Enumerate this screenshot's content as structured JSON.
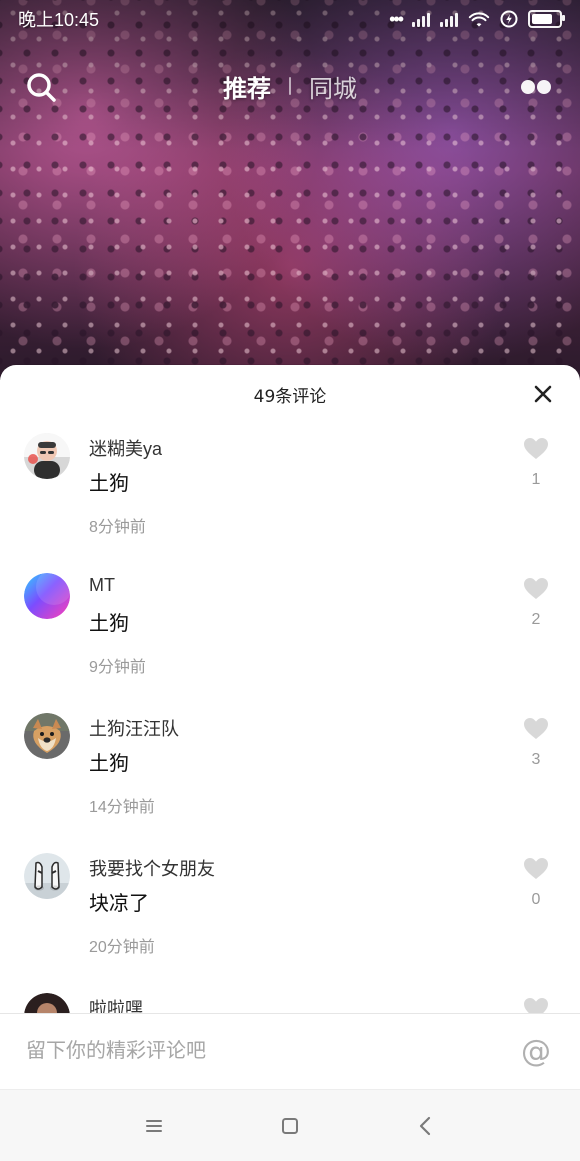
{
  "status_bar": {
    "time": "晚上10:45"
  },
  "top_nav": {
    "tabs": [
      {
        "label": "推荐",
        "active": true
      },
      {
        "label": "同城",
        "active": false
      }
    ],
    "icons": {
      "search": "search-icon",
      "more": "dots-icon"
    }
  },
  "comments_sheet": {
    "title": "49条评论",
    "close_icon": "close-icon",
    "comments": [
      {
        "user": "迷糊美ya",
        "text": "土狗",
        "time": "8分钟前",
        "likes": "1",
        "avatar": "avatar-photo"
      },
      {
        "user": "MT",
        "text": "土狗",
        "time": "9分钟前",
        "likes": "2",
        "avatar": "avatar-gradient"
      },
      {
        "user": "土狗汪汪队",
        "text": "土狗",
        "time": "14分钟前",
        "likes": "3",
        "avatar": "avatar-dog"
      },
      {
        "user": "我要找个女朋友",
        "text": "块凉了",
        "time": "20分钟前",
        "likes": "0",
        "avatar": "avatar-shoes"
      }
    ],
    "partial_comment": {
      "user": "啦啦嘿"
    },
    "input": {
      "placeholder": "留下你的精彩评论吧"
    },
    "mention_icon": "at-icon"
  },
  "system_nav": {
    "icons": [
      "menu-icon",
      "home-icon",
      "back-icon"
    ]
  },
  "colors": {
    "accent_pink": "#ff4fa6",
    "text_primary": "#111111",
    "text_secondary": "#9a9a9a"
  }
}
